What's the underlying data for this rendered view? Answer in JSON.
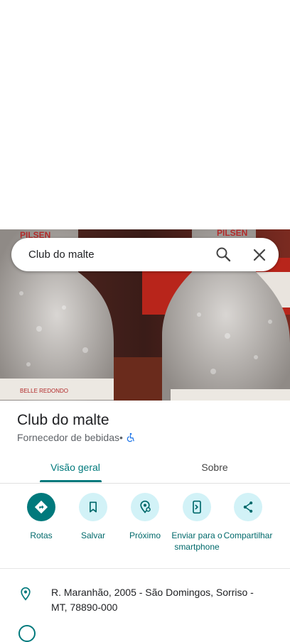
{
  "search": {
    "query": "Club do malte"
  },
  "place": {
    "name": "Club do malte",
    "category": "Fornecedor de bebidas",
    "separator": " • "
  },
  "photo": {
    "labels": [
      "PILSEN",
      "PILSEN",
      "BELLE REDONDO"
    ]
  },
  "tabs": [
    {
      "label": "Visão geral",
      "active": true
    },
    {
      "label": "Sobre",
      "active": false
    }
  ],
  "actions": [
    {
      "label": "Rotas",
      "icon": "directions-icon"
    },
    {
      "label": "Salvar",
      "icon": "bookmark-icon"
    },
    {
      "label": "Próximo",
      "icon": "nearby-icon"
    },
    {
      "label": "Enviar para o smartphone",
      "icon": "send-to-phone-icon"
    },
    {
      "label": "Compartilhar",
      "icon": "share-icon"
    }
  ],
  "address": "R. Maranhão, 2005 - São Domingos, Sorriso - MT, 78890-000",
  "colors": {
    "accent": "#00797c",
    "action_bg": "#d2f2f7"
  }
}
